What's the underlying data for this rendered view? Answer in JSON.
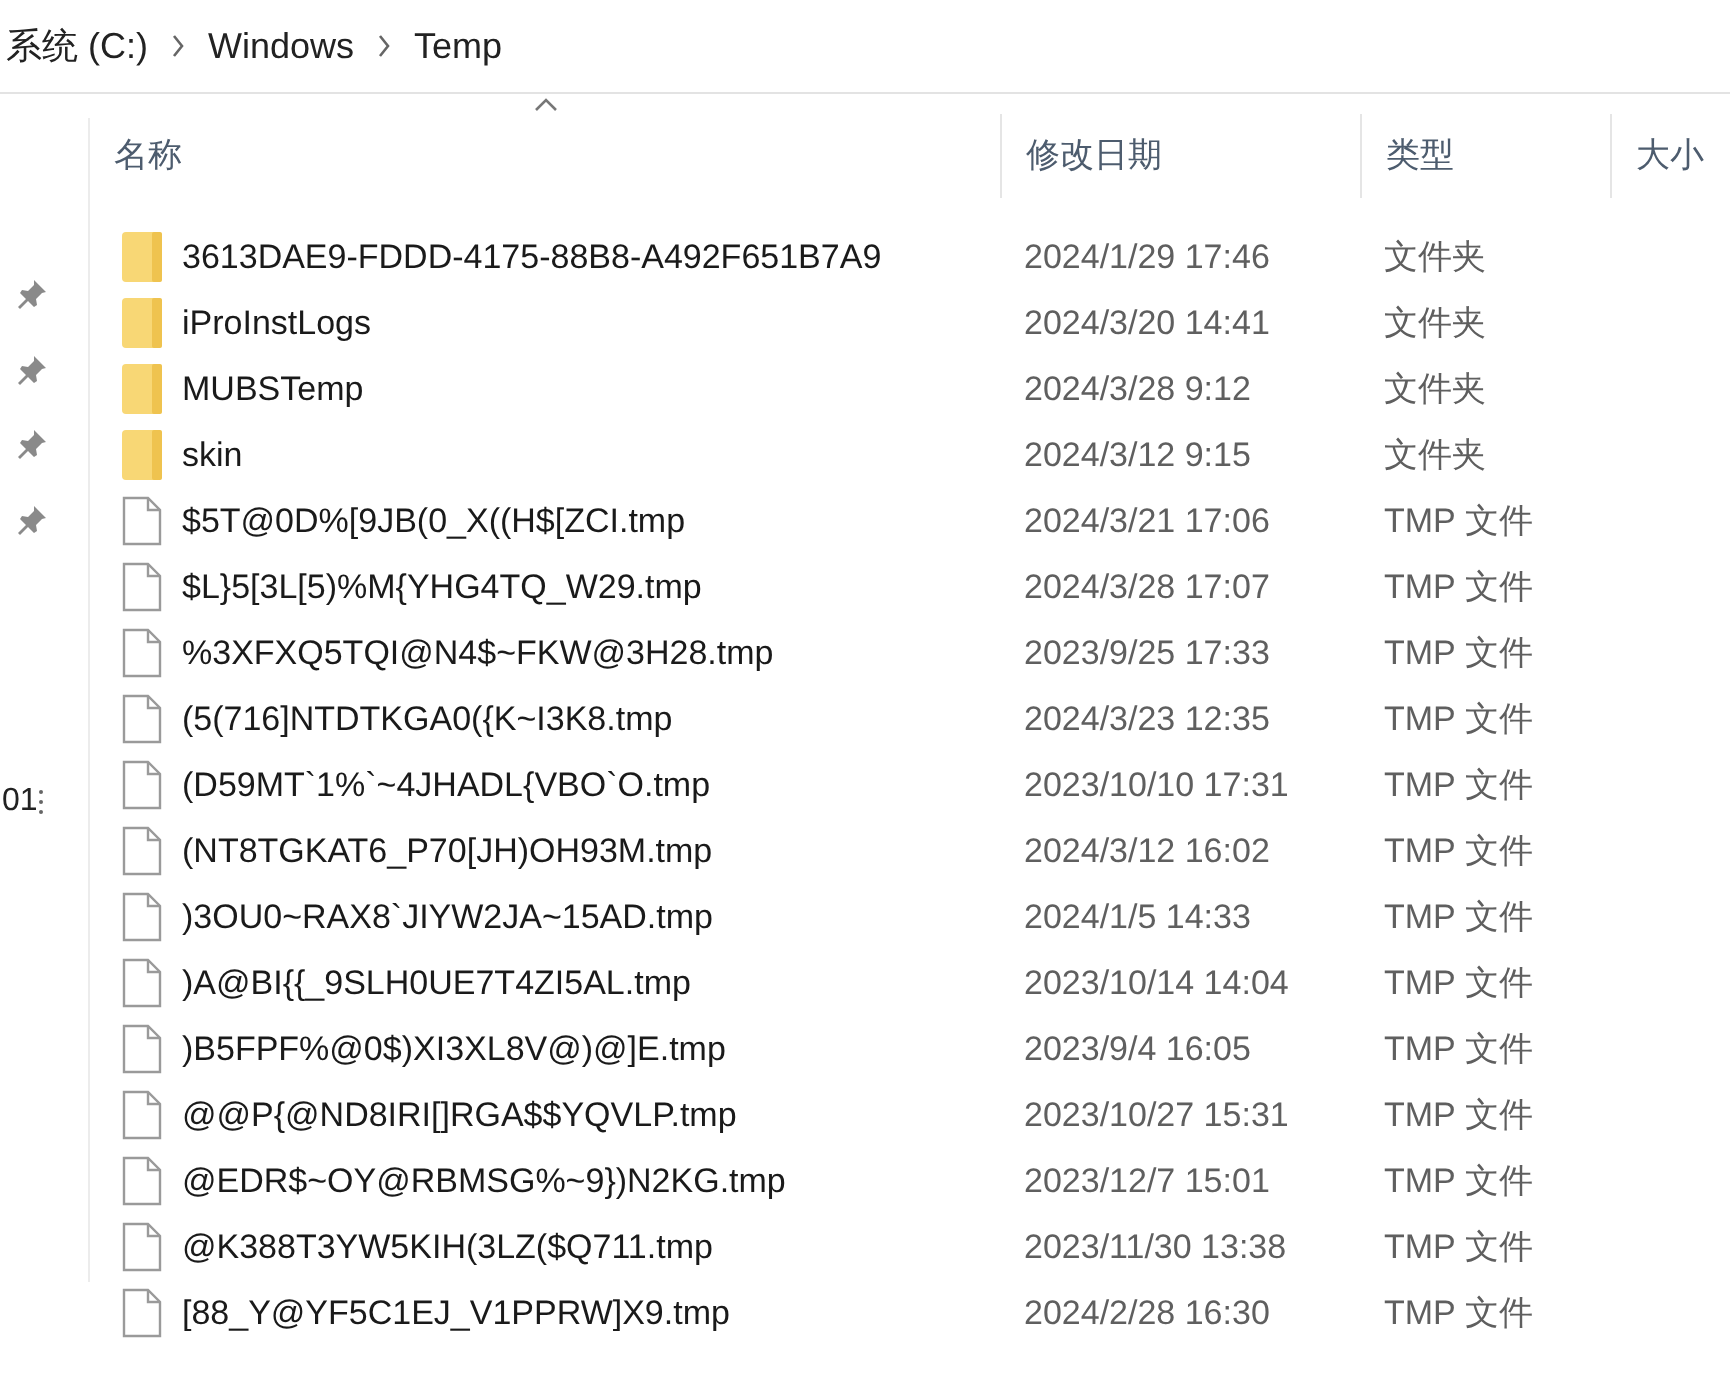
{
  "breadcrumb": [
    "系统 (C:)",
    "Windows",
    "Temp"
  ],
  "sidebar": {
    "items": [
      {
        "pinned": true
      },
      {
        "pinned": true
      },
      {
        "pinned": true
      },
      {
        "pinned": true
      },
      {
        "label": "01",
        "pinned": false
      }
    ]
  },
  "table": {
    "columns": [
      {
        "label": "名称",
        "sorted": true
      },
      {
        "label": "修改日期",
        "sorted": false
      },
      {
        "label": "类型",
        "sorted": false
      },
      {
        "label": "大小",
        "sorted": false
      }
    ],
    "rows": [
      {
        "kind": "folder",
        "name": "3613DAE9-FDDD-4175-88B8-A492F651B7A9",
        "date": "2024/1/29 17:46",
        "type": "文件夹"
      },
      {
        "kind": "folder",
        "name": "iProInstLogs",
        "date": "2024/3/20 14:41",
        "type": "文件夹"
      },
      {
        "kind": "folder",
        "name": "MUBSTemp",
        "date": "2024/3/28 9:12",
        "type": "文件夹"
      },
      {
        "kind": "folder",
        "name": "skin",
        "date": "2024/3/12 9:15",
        "type": "文件夹"
      },
      {
        "kind": "file",
        "name": "$5T@0D%[9JB(0_X((H$[ZCI.tmp",
        "date": "2024/3/21 17:06",
        "type": "TMP 文件"
      },
      {
        "kind": "file",
        "name": "$L}5[3L[5)%M{YHG4TQ_W29.tmp",
        "date": "2024/3/28 17:07",
        "type": "TMP 文件"
      },
      {
        "kind": "file",
        "name": "%3XFXQ5TQI@N4$~FKW@3H28.tmp",
        "date": "2023/9/25 17:33",
        "type": "TMP 文件"
      },
      {
        "kind": "file",
        "name": "(5(716]NTDTKGA0({K~I3K8.tmp",
        "date": "2024/3/23 12:35",
        "type": "TMP 文件"
      },
      {
        "kind": "file",
        "name": "(D59MT`1%`~4JHADL{VBO`O.tmp",
        "date": "2023/10/10 17:31",
        "type": "TMP 文件"
      },
      {
        "kind": "file",
        "name": "(NT8TGKAT6_P70[JH)OH93M.tmp",
        "date": "2024/3/12 16:02",
        "type": "TMP 文件"
      },
      {
        "kind": "file",
        "name": ")3OU0~RAX8`JIYW2JA~15AD.tmp",
        "date": "2024/1/5 14:33",
        "type": "TMP 文件"
      },
      {
        "kind": "file",
        "name": ")A@BI{{_9SLH0UE7T4ZI5AL.tmp",
        "date": "2023/10/14 14:04",
        "type": "TMP 文件"
      },
      {
        "kind": "file",
        "name": ")B5FPF%@0$)XI3XL8V@)@]E.tmp",
        "date": "2023/9/4 16:05",
        "type": "TMP 文件"
      },
      {
        "kind": "file",
        "name": "@@P{@ND8IRI[]RGA$$YQVLP.tmp",
        "date": "2023/10/27 15:31",
        "type": "TMP 文件"
      },
      {
        "kind": "file",
        "name": "@EDR$~OY@RBMSG%~9})N2KG.tmp",
        "date": "2023/12/7 15:01",
        "type": "TMP 文件"
      },
      {
        "kind": "file",
        "name": "@K388T3YW5KIH(3LZ($Q711.tmp",
        "date": "2023/11/30 13:38",
        "type": "TMP 文件"
      },
      {
        "kind": "file",
        "name": "[88_Y@YF5C1EJ_V1PPRW]X9.tmp",
        "date": "2024/2/28 16:30",
        "type": "TMP 文件"
      }
    ]
  }
}
